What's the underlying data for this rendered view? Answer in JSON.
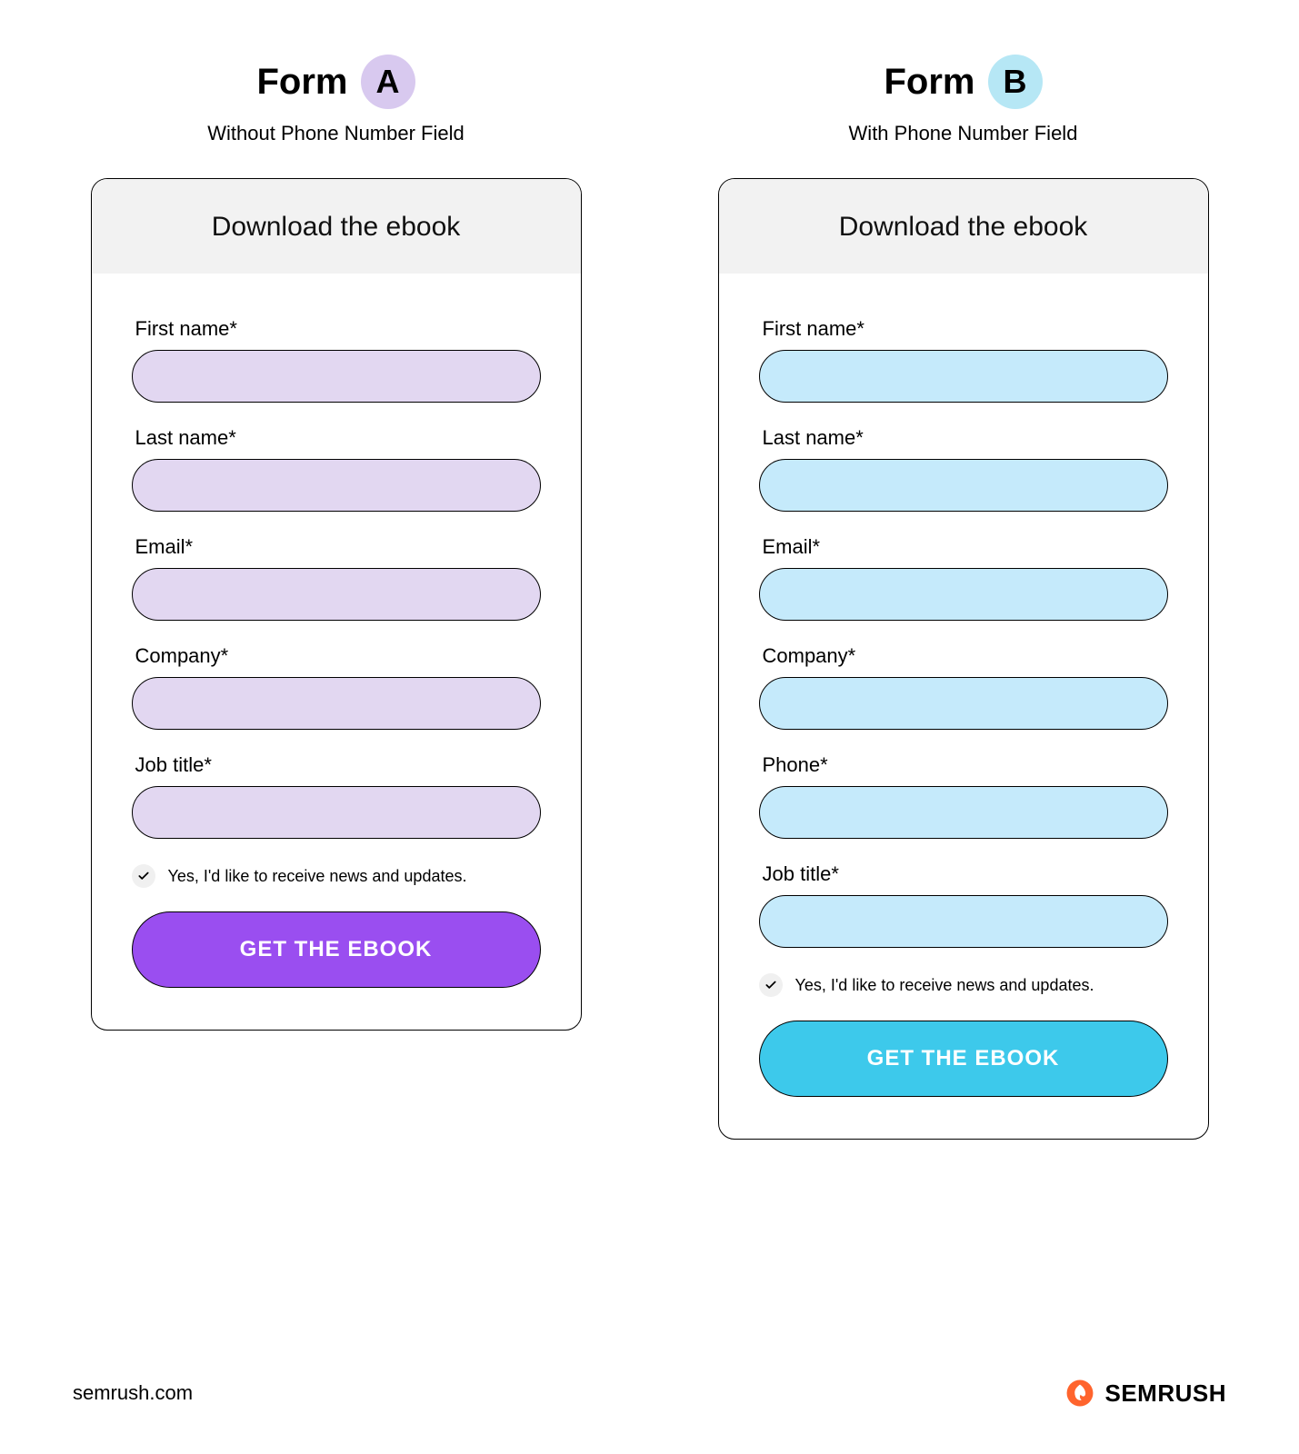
{
  "forms": {
    "a": {
      "label_prefix": "Form",
      "badge": "A",
      "subtitle": "Without Phone Number Field",
      "header": "Download the ebook",
      "fields": [
        {
          "label": "First name*"
        },
        {
          "label": "Last name*"
        },
        {
          "label": "Email*"
        },
        {
          "label": "Company*"
        },
        {
          "label": "Job title*"
        }
      ],
      "consent": "Yes, I'd like to receive news and updates.",
      "button": "GET THE EBOOK",
      "colors": {
        "badge": "#d8c9ef",
        "input": "#e2d7f1",
        "button": "#9a4ef0"
      }
    },
    "b": {
      "label_prefix": "Form",
      "badge": "B",
      "subtitle": "With Phone Number Field",
      "header": "Download the ebook",
      "fields": [
        {
          "label": "First name*"
        },
        {
          "label": "Last name*"
        },
        {
          "label": "Email*"
        },
        {
          "label": "Company*"
        },
        {
          "label": "Phone*"
        },
        {
          "label": "Job title*"
        }
      ],
      "consent": "Yes, I'd like to receive news and updates.",
      "button": "GET THE EBOOK",
      "colors": {
        "badge": "#b6e7f5",
        "input": "#c5eafb",
        "button": "#3dc9eb"
      }
    }
  },
  "footer": {
    "url": "semrush.com",
    "brand": "SEMRUSH"
  }
}
